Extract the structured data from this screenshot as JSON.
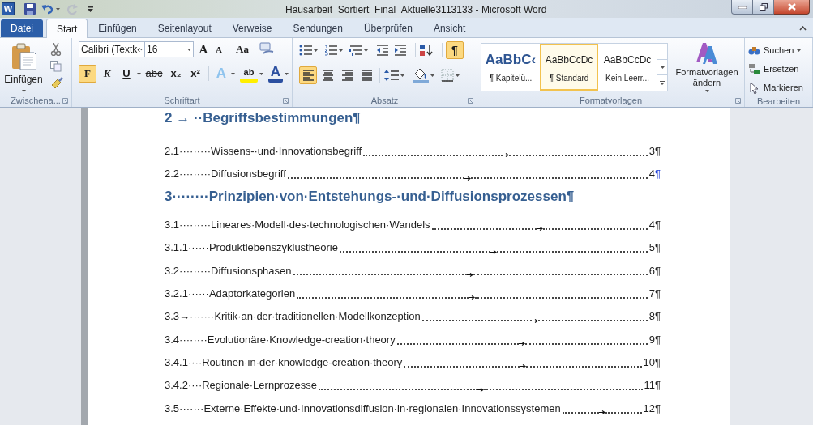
{
  "window": {
    "title": "Hausarbeit_Sortiert_Final_Aktuelle3113133  -  Microsoft Word",
    "app_letter": "W"
  },
  "file_button": {
    "label": "Datei"
  },
  "tabs": [
    {
      "label": "Start",
      "selected": true
    },
    {
      "label": "Einfügen",
      "selected": false
    },
    {
      "label": "Seitenlayout",
      "selected": false
    },
    {
      "label": "Verweise",
      "selected": false
    },
    {
      "label": "Sendungen",
      "selected": false
    },
    {
      "label": "Überprüfen",
      "selected": false
    },
    {
      "label": "Ansicht",
      "selected": false
    }
  ],
  "clipboard": {
    "paste_label": "Einfügen",
    "group_label": "Zwischena..."
  },
  "font": {
    "font_name": "Calibri (Textk‹",
    "font_size": "16",
    "group_label": "Schriftart",
    "size_buttons": [
      {
        "label": "A",
        "kind": "grow"
      },
      {
        "label": "A",
        "kind": "shrink"
      },
      {
        "label": "Aa",
        "kind": "case"
      }
    ],
    "format_buttons": [
      {
        "label": "F",
        "kind": "bold",
        "on": true
      },
      {
        "label": "K",
        "kind": "italic",
        "on": false
      },
      {
        "label": "U",
        "kind": "underline",
        "on": false
      },
      {
        "label": "abc",
        "kind": "strike",
        "on": false
      },
      {
        "label": "x₂",
        "kind": "plain",
        "on": false
      },
      {
        "label": "x²",
        "kind": "plain",
        "on": false
      }
    ],
    "effect_buttons": [
      {
        "label": "A",
        "kind": "effects"
      },
      {
        "label": "ab",
        "kind": "highlight"
      },
      {
        "label": "A",
        "kind": "color"
      }
    ]
  },
  "paragraph": {
    "group_label": "Absatz",
    "show_marks": {
      "label": "¶",
      "on": true
    },
    "alignments": [
      {
        "kind": "left",
        "selected": true
      },
      {
        "kind": "center",
        "selected": false
      },
      {
        "kind": "right",
        "selected": false
      },
      {
        "kind": "justify",
        "selected": false
      }
    ]
  },
  "styles": {
    "group_label": "Formatvorlagen",
    "change_label": "Formatvorlagen ändern",
    "items": [
      {
        "preview": "AaBbC‹",
        "name": "¶ Kapitelü...",
        "kind": "heading",
        "selected": false
      },
      {
        "preview": "AaBbCcDc",
        "name": "¶ Standard",
        "kind": "normal",
        "selected": true
      },
      {
        "preview": "AaBbCcDc",
        "name": "Kein Leerr...",
        "kind": "normal",
        "selected": false
      }
    ]
  },
  "editing": {
    "group_label": "Bearbeiten",
    "items": [
      {
        "label": "Suchen",
        "kind": "find"
      },
      {
        "label": "Ersetzen",
        "kind": "replace"
      },
      {
        "label": "Markieren",
        "kind": "select"
      }
    ]
  },
  "document": {
    "cut_heading": "2 → ··Begriffsbestimmungen¶",
    "entries": [
      {
        "kind": "entry",
        "text": "2.1·········Wissens-·und·Innovationsbegriff",
        "page": "3",
        "mark": "¶",
        "mark_highlighted": false
      },
      {
        "kind": "entry",
        "text": "2.2·········Diffusionsbegriff",
        "page": "4",
        "mark": "¶",
        "mark_highlighted": true
      },
      {
        "kind": "heading",
        "text": "3········Prinzipien·von·Entstehungs-·und·Diffusionsprozessen¶"
      },
      {
        "kind": "entry",
        "text": "3.1·········Lineares·Modell·des·technologischen·Wandels",
        "page": "4",
        "mark": "¶",
        "mark_highlighted": false
      },
      {
        "kind": "entry",
        "text": "3.1.1······Produktlebenszyklustheorie",
        "page": "5",
        "mark": "¶",
        "mark_highlighted": false
      },
      {
        "kind": "entry",
        "text": "3.2·········Diffusionsphasen",
        "page": "6",
        "mark": "¶",
        "mark_highlighted": false
      },
      {
        "kind": "entry",
        "text": "3.2.1······Adaptorkategorien",
        "page": "7",
        "mark": "¶",
        "mark_highlighted": false
      },
      {
        "kind": "entry",
        "text": "3.3→·······Kritik·an·der·traditionellen·Modellkonzeption",
        "page": "8",
        "mark": "¶",
        "mark_highlighted": false
      },
      {
        "kind": "entry",
        "text": "3.4········Evolutionäre·Knowledge-creation·theory",
        "page": "9",
        "mark": "¶",
        "mark_highlighted": false
      },
      {
        "kind": "entry",
        "text": "3.4.1····Routinen·in·der·knowledge-creation·theory",
        "page": "10",
        "mark": "¶",
        "mark_highlighted": false
      },
      {
        "kind": "entry",
        "text": "3.4.2····Regionale·Lernprozesse",
        "page": "11",
        "mark": "¶",
        "mark_highlighted": false
      },
      {
        "kind": "entry",
        "text": "3.5·······Externe·Effekte·und·Innovationsdiffusion·in·regionalen·Innovationssystemen",
        "page": "12",
        "mark": "¶",
        "mark_highlighted": false
      }
    ]
  }
}
